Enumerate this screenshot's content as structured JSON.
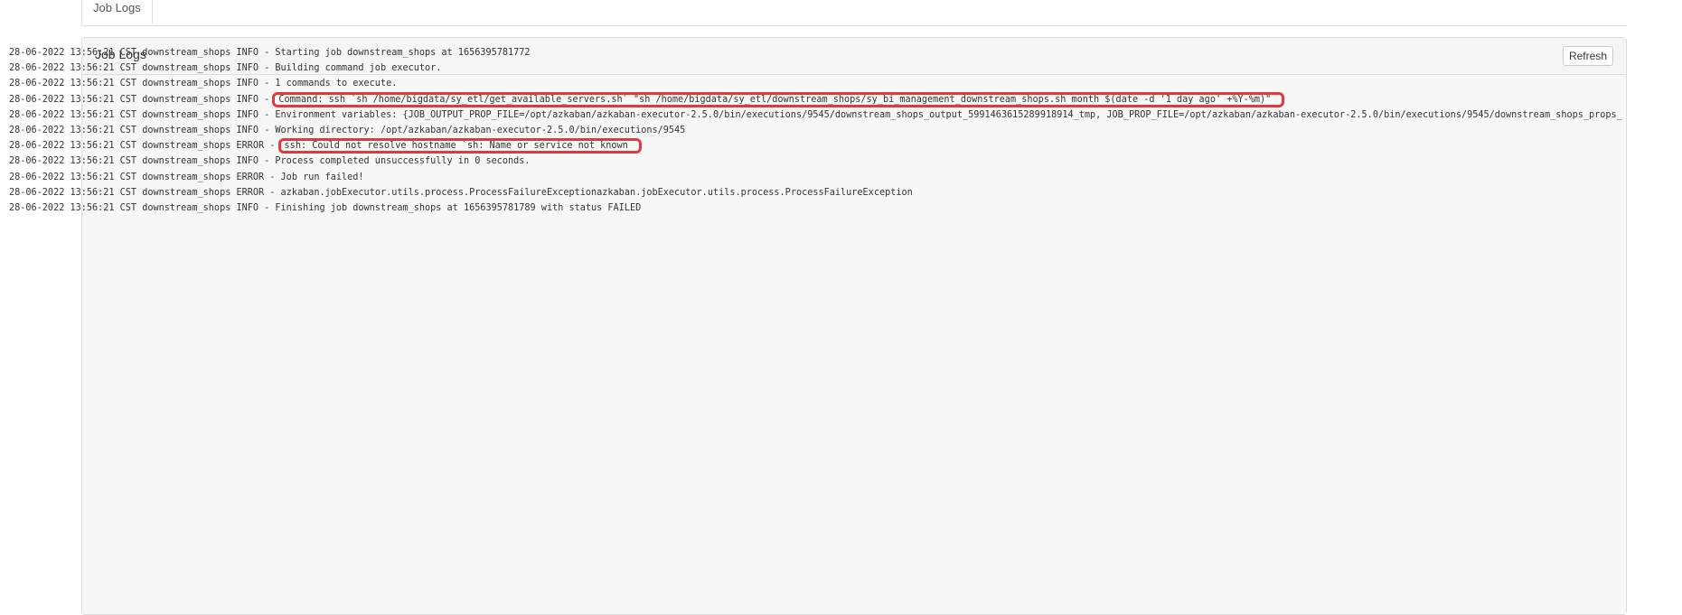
{
  "tabs": [
    {
      "label": "Job Logs"
    }
  ],
  "panel": {
    "title": "Job Logs",
    "refresh_label": "Refresh"
  },
  "log": {
    "lines": [
      {
        "prefix": "28-06-2022 13:56:21 CST downstream_shops INFO - ",
        "message": "Starting job downstream_shops at 1656395781772"
      },
      {
        "prefix": "28-06-2022 13:56:21 CST downstream_shops INFO - ",
        "message": "Building command job executor."
      },
      {
        "prefix": "28-06-2022 13:56:21 CST downstream_shops INFO - ",
        "message": "1 commands to execute."
      },
      {
        "prefix": "28-06-2022 13:56:21 CST downstream_shops INFO - ",
        "message": "Command: ssh `sh /home/bigdata/sy_etl/get_available_servers.sh` \"sh /home/bigdata/sy_etl/downstream_shops/sy_bi_management_downstream_shops.sh month $(date -d '1 day ago' +%Y-%m)\"",
        "highlight": true
      },
      {
        "prefix": "28-06-2022 13:56:21 CST downstream_shops INFO - ",
        "message": "Environment variables: {JOB_OUTPUT_PROP_FILE=/opt/azkaban/azkaban-executor-2.5.0/bin/executions/9545/downstream_shops_output_5991463615289918914_tmp, JOB_PROP_FILE=/opt/azkaban/azkaban-executor-2.5.0/bin/executions/9545/downstream_shops_props_"
      },
      {
        "prefix": "28-06-2022 13:56:21 CST downstream_shops INFO - ",
        "message": "Working directory: /opt/azkaban/azkaban-executor-2.5.0/bin/executions/9545"
      },
      {
        "prefix": "28-06-2022 13:56:21 CST downstream_shops ERROR - ",
        "message": "ssh: Could not resolve hostname `sh: Name or service not known",
        "highlight": true
      },
      {
        "prefix": "28-06-2022 13:56:21 CST downstream_shops INFO - ",
        "message": "Process completed unsuccessfully in 0 seconds."
      },
      {
        "prefix": "28-06-2022 13:56:21 CST downstream_shops ERROR - ",
        "message": "Job run failed!"
      },
      {
        "prefix": "28-06-2022 13:56:21 CST downstream_shops ERROR - ",
        "message": "azkaban.jobExecutor.utils.process.ProcessFailureExceptionazkaban.jobExecutor.utils.process.ProcessFailureException"
      },
      {
        "prefix": "28-06-2022 13:56:21 CST downstream_shops INFO - ",
        "message": "Finishing job downstream_shops at 1656395781789 with status FAILED"
      }
    ]
  },
  "colors": {
    "highlight_border": "#e03a3e",
    "log_background": "#f7f7f7",
    "text": "#333333"
  }
}
